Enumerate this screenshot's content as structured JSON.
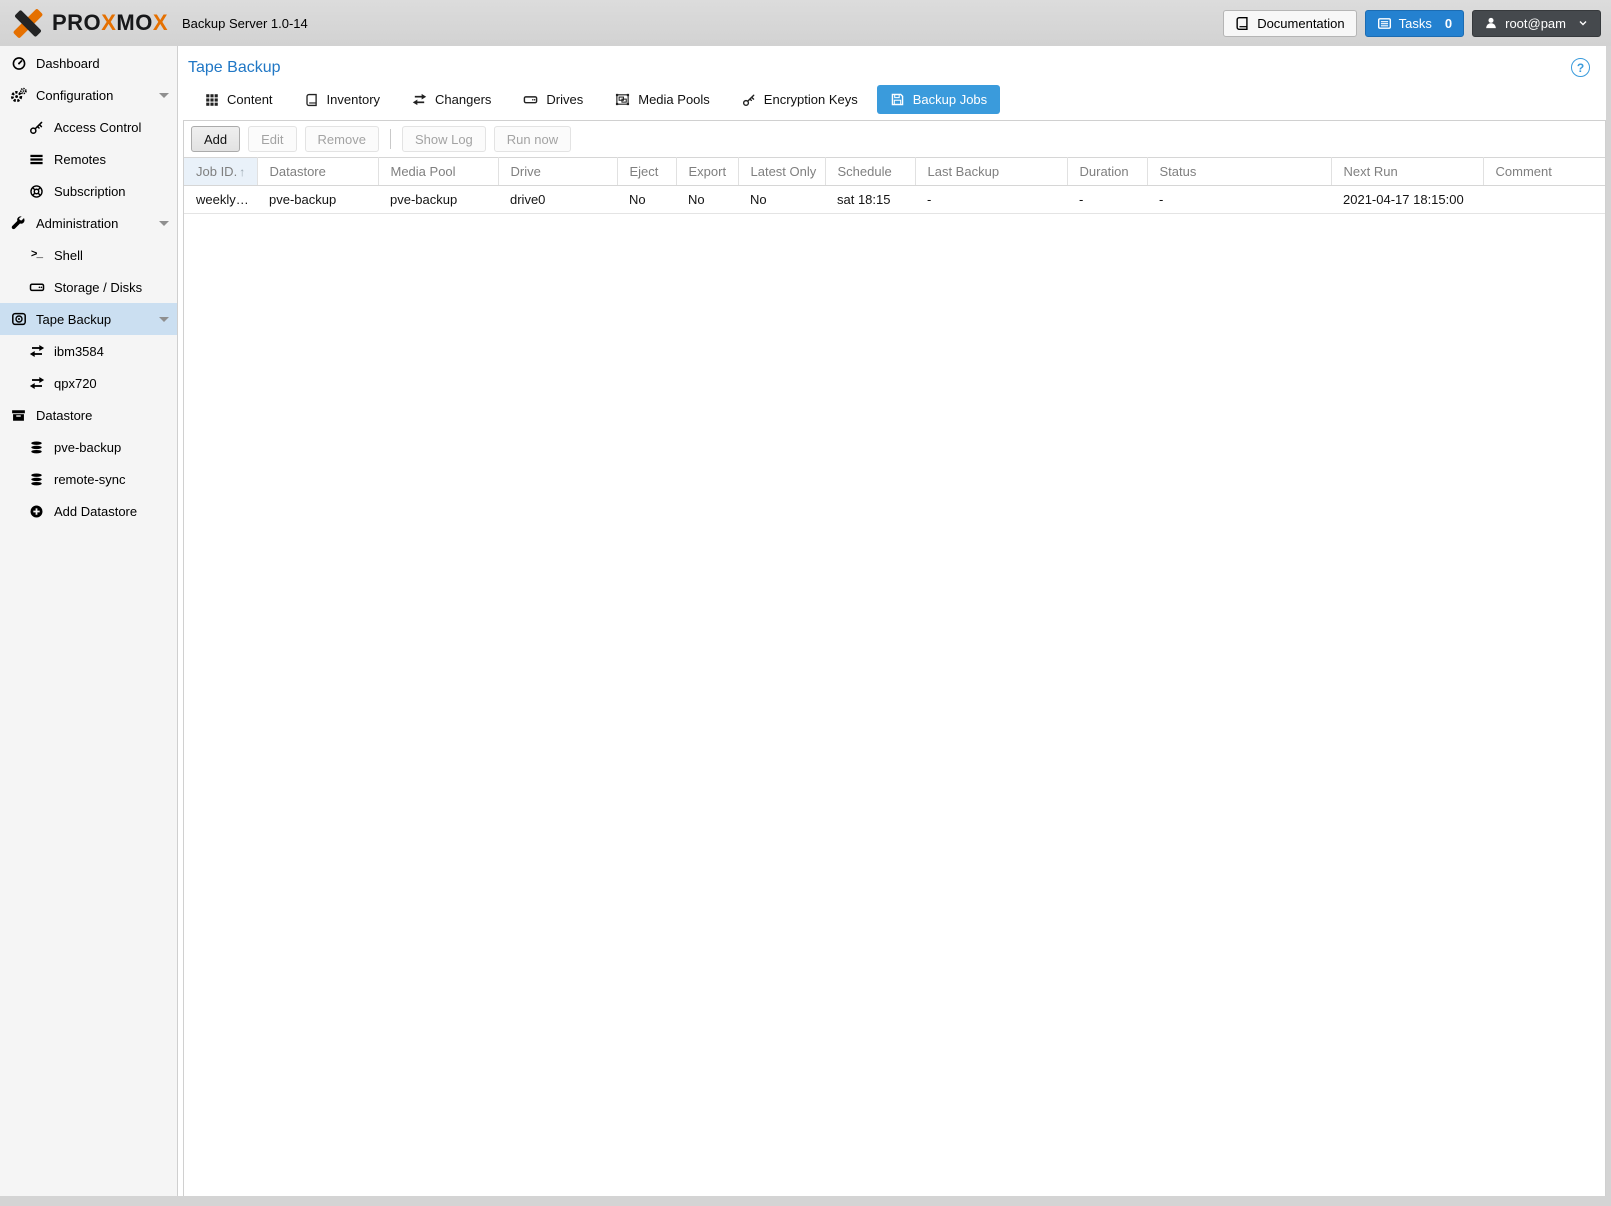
{
  "app": {
    "title": "Backup Server 1.0-14",
    "logo_segments": [
      {
        "text": "PRO",
        "accent": false
      },
      {
        "text": "X",
        "accent": true
      },
      {
        "text": "MO",
        "accent": false
      },
      {
        "text": "X",
        "accent": true
      }
    ]
  },
  "header": {
    "documentation_label": "Documentation",
    "tasks_label": "Tasks",
    "tasks_count": "0",
    "user_label": "root@pam"
  },
  "sidebar": {
    "items": [
      {
        "label": "Dashboard",
        "icon": "dashboard-icon",
        "level": 0
      },
      {
        "label": "Configuration",
        "icon": "gears-icon",
        "level": 0,
        "expandable": true
      },
      {
        "label": "Access Control",
        "icon": "key-icon",
        "level": 1
      },
      {
        "label": "Remotes",
        "icon": "list-icon",
        "level": 1
      },
      {
        "label": "Subscription",
        "icon": "support-icon",
        "level": 1
      },
      {
        "label": "Administration",
        "icon": "wrench-icon",
        "level": 0,
        "expandable": true
      },
      {
        "label": "Shell",
        "icon": "terminal-icon",
        "level": 1
      },
      {
        "label": "Storage / Disks",
        "icon": "hdd-icon",
        "level": 1
      },
      {
        "label": "Tape Backup",
        "icon": "tape-icon",
        "level": 0,
        "expandable": true,
        "selected": true
      },
      {
        "label": "ibm3584",
        "icon": "exchange-icon",
        "level": 1
      },
      {
        "label": "qpx720",
        "icon": "exchange-icon",
        "level": 1
      },
      {
        "label": "Datastore",
        "icon": "archive-icon",
        "level": 0
      },
      {
        "label": "pve-backup",
        "icon": "database-icon",
        "level": 1
      },
      {
        "label": "remote-sync",
        "icon": "database-icon",
        "level": 1
      },
      {
        "label": "Add Datastore",
        "icon": "plus-circle-icon",
        "level": 1
      }
    ]
  },
  "content": {
    "title": "Tape Backup",
    "tabs": [
      {
        "label": "Content",
        "icon": "grid-icon",
        "active": false
      },
      {
        "label": "Inventory",
        "icon": "book-icon",
        "active": false
      },
      {
        "label": "Changers",
        "icon": "exchange-icon",
        "active": false
      },
      {
        "label": "Drives",
        "icon": "hdd-icon",
        "active": false
      },
      {
        "label": "Media Pools",
        "icon": "object-group-icon",
        "active": false
      },
      {
        "label": "Encryption Keys",
        "icon": "key-icon",
        "active": false
      },
      {
        "label": "Backup Jobs",
        "icon": "save-icon",
        "active": true
      }
    ],
    "toolbar": {
      "buttons": [
        {
          "label": "Add",
          "enabled": true
        },
        {
          "label": "Edit",
          "enabled": false
        },
        {
          "label": "Remove",
          "enabled": false
        },
        {
          "label": "Show Log",
          "enabled": false
        },
        {
          "label": "Run now",
          "enabled": false
        }
      ]
    },
    "table": {
      "sort_indicator": "↑",
      "columns": [
        {
          "label": "Job ID.",
          "sorted": true
        },
        {
          "label": "Datastore"
        },
        {
          "label": "Media Pool"
        },
        {
          "label": "Drive"
        },
        {
          "label": "Eject"
        },
        {
          "label": "Export"
        },
        {
          "label": "Latest Only"
        },
        {
          "label": "Schedule"
        },
        {
          "label": "Last Backup"
        },
        {
          "label": "Duration"
        },
        {
          "label": "Status"
        },
        {
          "label": "Next Run"
        },
        {
          "label": "Comment"
        }
      ],
      "rows": [
        [
          "weekly…",
          "pve-backup",
          "pve-backup",
          "drive0",
          "No",
          "No",
          "No",
          "sat 18:15",
          "-",
          "-",
          "-",
          "2021-04-17 18:15:00",
          ""
        ]
      ]
    }
  },
  "colors": {
    "logo_accent": "#e57000",
    "topbar_bg": "#d7d7d7",
    "tasks_button_bg": "#2481d0",
    "user_button_bg": "#45494d",
    "page_title_text": "#2077c5",
    "active_tab_bg": "#3a9bdc",
    "selected_nav_bg": "#cbdff1",
    "sorted_column_bg": "#e9f1f9"
  }
}
